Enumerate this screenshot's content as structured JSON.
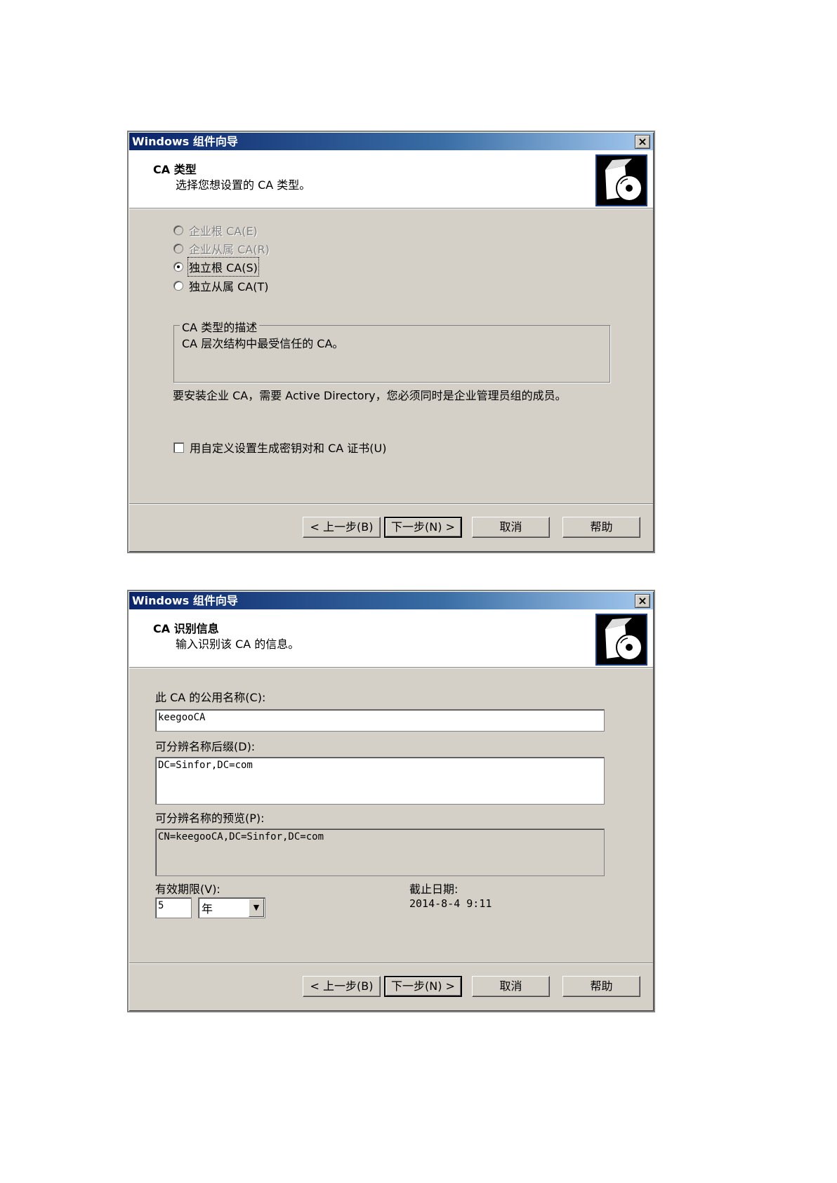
{
  "dialog1": {
    "title": "Windows 组件向导",
    "close": "×",
    "header_title": "CA 类型",
    "header_subtitle": "选择您想设置的 CA 类型。",
    "options": [
      {
        "label": "企业根 CA(E)",
        "enabled": false,
        "checked": false
      },
      {
        "label": "企业从属 CA(R)",
        "enabled": false,
        "checked": false
      },
      {
        "label": "独立根 CA(S)",
        "enabled": true,
        "checked": true
      },
      {
        "label": "独立从属 CA(T)",
        "enabled": true,
        "checked": false
      }
    ],
    "group_label": "CA 类型的描述",
    "group_text": "CA 层次结构中最受信任的 CA。",
    "note": "要安装企业 CA，需要 Active Directory，您必须同时是企业管理员组的成员。",
    "checkbox_label": "用自定义设置生成密钥对和 CA 证书(U)",
    "buttons": {
      "back": "< 上一步(B)",
      "next": "下一步(N) >",
      "cancel": "取消",
      "help": "帮助"
    }
  },
  "dialog2": {
    "title": "Windows 组件向导",
    "close": "×",
    "header_title": "CA 识别信息",
    "header_subtitle": "输入识别该 CA 的信息。",
    "common_name_label": "此 CA 的公用名称(C):",
    "common_name_value": "keegooCA",
    "dn_suffix_label": "可分辨名称后缀(D):",
    "dn_suffix_value": "DC=Sinfor,DC=com",
    "preview_label": "可分辨名称的预览(P):",
    "preview_value": "CN=keegooCA,DC=Sinfor,DC=com",
    "validity_label": "有效期限(V):",
    "validity_value": "5",
    "validity_unit": "年",
    "expiry_label": "截止日期:",
    "expiry_value": "2014-8-4 9:11",
    "buttons": {
      "back": "< 上一步(B)",
      "next": "下一步(N) >",
      "cancel": "取消",
      "help": "帮助"
    }
  }
}
